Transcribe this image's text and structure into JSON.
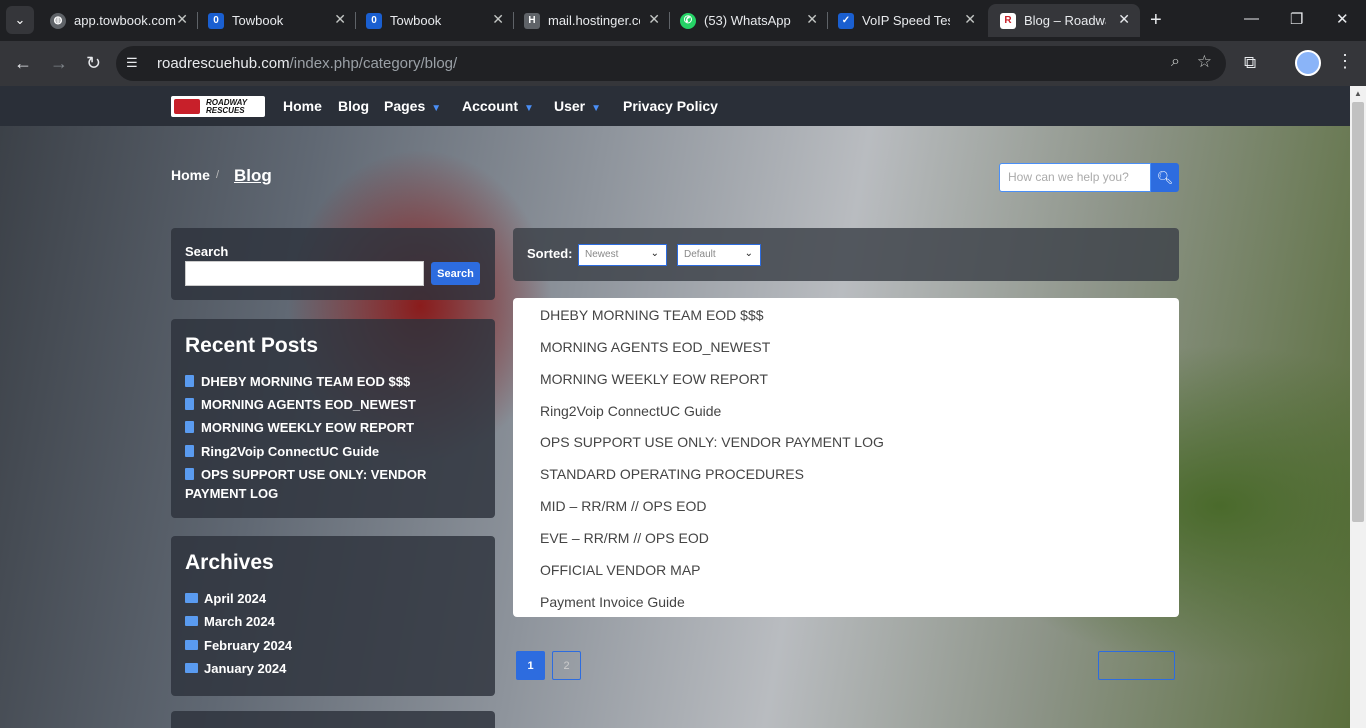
{
  "browser": {
    "tabs": [
      {
        "title": "app.towbook.com",
        "favicon": "globe-icon",
        "active": false
      },
      {
        "title": "Towbook",
        "favicon": "towbook-icon",
        "active": false
      },
      {
        "title": "Towbook",
        "favicon": "towbook-icon",
        "active": false
      },
      {
        "title": "mail.hostinger.com",
        "favicon": "mail-icon",
        "active": false
      },
      {
        "title": "(53) WhatsApp",
        "favicon": "whatsapp-icon",
        "active": false
      },
      {
        "title": "VoIP Speed Test",
        "favicon": "check-icon",
        "active": false
      },
      {
        "title": "Blog – Roadway Rescues",
        "favicon": "roadway-icon",
        "active": true
      }
    ],
    "tab_menu_icon": "chevron-down-icon",
    "new_tab": "+",
    "url_host": "roadrescuehub.com",
    "url_path": "/index.php/category/blog/"
  },
  "site": {
    "logo_text": "ROADWAY RESCUES",
    "nav": [
      {
        "label": "Home",
        "dropdown": false
      },
      {
        "label": "Blog",
        "dropdown": false
      },
      {
        "label": "Pages",
        "dropdown": true
      },
      {
        "label": "Account",
        "dropdown": true
      },
      {
        "label": "User",
        "dropdown": true
      },
      {
        "label": "Privacy Policy",
        "dropdown": false
      }
    ],
    "breadcrumb": {
      "home": "Home",
      "separator": "/",
      "current": "Blog"
    },
    "top_search_placeholder": "How can we help you?",
    "accent_color": "#2d6cdf"
  },
  "sidebar": {
    "search": {
      "label": "Search",
      "button": "Search"
    },
    "recent_posts": {
      "title": "Recent Posts",
      "items": [
        "DHEBY MORNING TEAM EOD $$$",
        "MORNING AGENTS EOD_NEWEST",
        "MORNING WEEKLY EOW REPORT",
        "Ring2Voip ConnectUC Guide",
        "OPS SUPPORT USE ONLY: VENDOR PAYMENT LOG"
      ]
    },
    "archives": {
      "title": "Archives",
      "items": [
        "April 2024",
        "March 2024",
        "February 2024",
        "January 2024"
      ]
    }
  },
  "main": {
    "sort_label": "Sorted:",
    "sort_order": "Newest",
    "sort_mode": "Default",
    "posts": [
      "DHEBY MORNING TEAM EOD $$$",
      "MORNING AGENTS EOD_NEWEST",
      "MORNING WEEKLY EOW REPORT",
      "Ring2Voip ConnectUC Guide",
      "OPS SUPPORT USE ONLY: VENDOR PAYMENT LOG",
      "STANDARD OPERATING PROCEDURES",
      "MID – RR/RM // OPS EOD",
      "EVE – RR/RM // OPS EOD",
      "OFFICIAL VENDOR MAP",
      "Payment Invoice Guide"
    ],
    "pagination": {
      "current": "1",
      "next_page": "2"
    }
  }
}
